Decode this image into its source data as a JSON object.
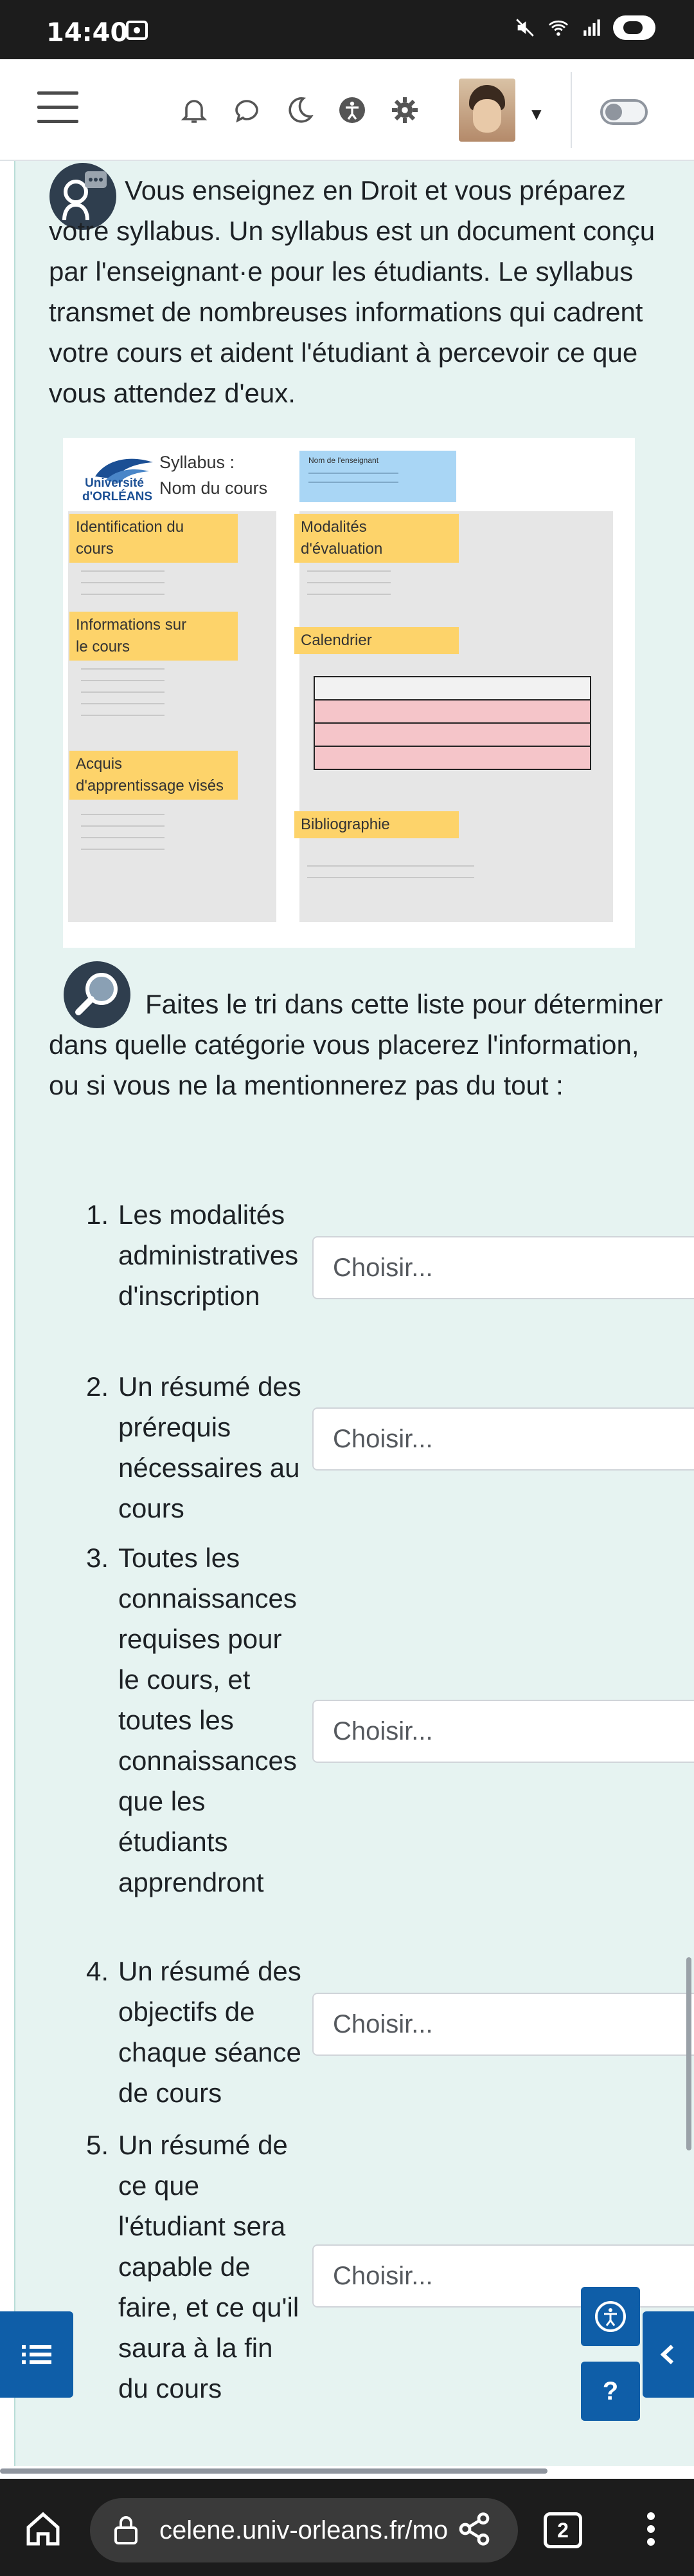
{
  "status_bar": {
    "time": "14:40"
  },
  "header": {
    "menu_icon": "hamburger-icon",
    "icons": [
      "bell-icon",
      "chat-icon",
      "moon-icon",
      "accessibility-icon",
      "gear-icon"
    ],
    "avatar": "user-avatar",
    "toggle_state": "off"
  },
  "intro": {
    "text": "Vous enseignez en Droit et vous préparez votre syllabus. Un syllabus est un document conçu par l'enseignant·e pour les étudiants. Le syllabus transmet de nombreuses informations qui cadrent votre cours et aident l'étudiant à percevoir ce que vous attendez d'eux."
  },
  "syllabus_figure": {
    "logo_line1": "Université",
    "logo_line2": "d'ORLÉANS",
    "title_line1": "Syllabus :",
    "title_line2": "Nom du cours",
    "teacher_label": "Nom de l'enseignant",
    "left_sections": [
      {
        "line1": "Identification du",
        "line2": "cours"
      },
      {
        "line1": "Informations sur",
        "line2": "le cours"
      },
      {
        "line1": "Acquis",
        "line2": "d'apprentissage visés"
      }
    ],
    "right_sections": [
      {
        "line1": "Modalités",
        "line2": "d'évaluation"
      },
      {
        "line1": "Calendrier",
        "line2": ""
      },
      {
        "line1": "Bibliographie",
        "line2": ""
      }
    ],
    "colors": {
      "tag": "#fdd36a",
      "teacher_box": "#a9d6f5",
      "calendar_rows": "#f5c5c9",
      "column_bg": "#e6e6e6"
    }
  },
  "question": {
    "text": "Faites le tri dans cette liste pour déterminer dans quelle catégorie vous placerez l'information, ou si vous ne la mentionnerez pas du tout :"
  },
  "items": [
    {
      "number": "1.",
      "label": "Les modalités administratives d'inscription",
      "select": "Choisir..."
    },
    {
      "number": "2.",
      "label": "Un résumé des prérequis nécessaires au cours",
      "select": "Choisir..."
    },
    {
      "number": "3.",
      "label": "Toutes les connaissances requises pour le cours, et toutes les connaissances que les étudiants apprendront",
      "select": "Choisir..."
    },
    {
      "number": "4.",
      "label": "Un résumé des objectifs de chaque séance de cours",
      "select": "Choisir..."
    },
    {
      "number": "5.",
      "label": "Un résumé de ce que l'étudiant sera capable de faire, et ce qu'il saura à la fin du cours",
      "select": "Choisir..."
    }
  ],
  "floating": {
    "help_label": "?"
  },
  "browser": {
    "url": "celene.univ-orleans.fr/mo",
    "tab_count": "2"
  },
  "accent_color": "#0f5ea8"
}
